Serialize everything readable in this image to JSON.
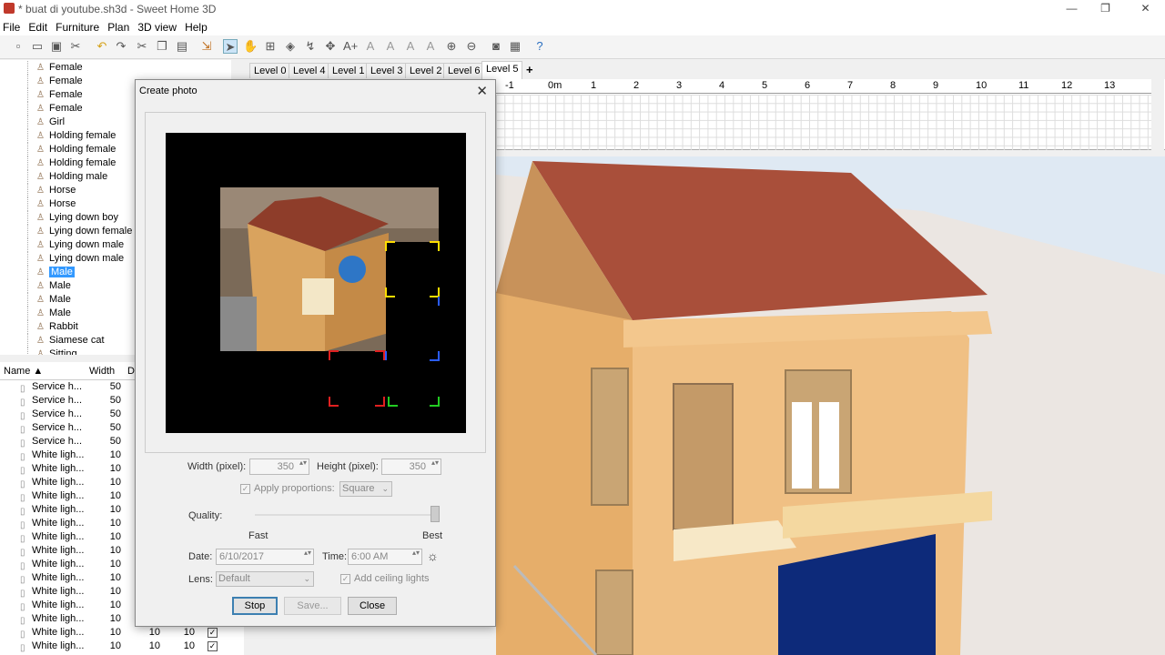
{
  "window": {
    "title": "* buat di youtube.sh3d - Sweet Home 3D"
  },
  "menu": [
    "File",
    "Edit",
    "Furniture",
    "Plan",
    "3D view",
    "Help"
  ],
  "toolbar_icons": [
    "new-icon",
    "open-icon",
    "save-icon",
    "cut-icon",
    "undo-icon",
    "redo-icon",
    "cut-icon",
    "copy-icon",
    "paste-icon",
    "add-furniture-icon",
    "select-icon",
    "pan-icon",
    "create-walls-icon",
    "create-rooms-icon",
    "create-polylines-icon",
    "create-dimensions-icon",
    "add-text-icon",
    "zoom-in-icon",
    "zoom-out-icon",
    "create-photo-icon",
    "create-video-icon",
    "help-icon"
  ],
  "furniture_tree": [
    "Female",
    "Female",
    "Female",
    "Female",
    "Girl",
    "Holding female",
    "Holding female",
    "Holding female",
    "Holding male",
    "Horse",
    "Horse",
    "Lying down boy",
    "Lying down female",
    "Lying down male",
    "Lying down male",
    "Male",
    "Male",
    "Male",
    "Male",
    "Rabbit",
    "Siamese cat",
    "Sitting"
  ],
  "furniture_tree_selected": 15,
  "furniture_table": {
    "columns": [
      "Name ▲",
      "Width",
      "De"
    ],
    "rows": [
      {
        "name": "Service h...",
        "width": "50",
        "depth": "",
        "height": "",
        "visible": false
      },
      {
        "name": "Service h...",
        "width": "50",
        "depth": "",
        "height": "",
        "visible": false
      },
      {
        "name": "Service h...",
        "width": "50",
        "depth": "",
        "height": "",
        "visible": false
      },
      {
        "name": "Service h...",
        "width": "50",
        "depth": "",
        "height": "",
        "visible": false
      },
      {
        "name": "Service h...",
        "width": "50",
        "depth": "",
        "height": "",
        "visible": false
      },
      {
        "name": "White ligh...",
        "width": "10",
        "depth": "",
        "height": "",
        "visible": false
      },
      {
        "name": "White ligh...",
        "width": "10",
        "depth": "",
        "height": "",
        "visible": false
      },
      {
        "name": "White ligh...",
        "width": "10",
        "depth": "",
        "height": "",
        "visible": false
      },
      {
        "name": "White ligh...",
        "width": "10",
        "depth": "",
        "height": "",
        "visible": false
      },
      {
        "name": "White ligh...",
        "width": "10",
        "depth": "",
        "height": "",
        "visible": false
      },
      {
        "name": "White ligh...",
        "width": "10",
        "depth": "",
        "height": "",
        "visible": false
      },
      {
        "name": "White ligh...",
        "width": "10",
        "depth": "",
        "height": "",
        "visible": false
      },
      {
        "name": "White ligh...",
        "width": "10",
        "depth": "",
        "height": "",
        "visible": false
      },
      {
        "name": "White ligh...",
        "width": "10",
        "depth": "",
        "height": "",
        "visible": false
      },
      {
        "name": "White ligh...",
        "width": "10",
        "depth": "",
        "height": "",
        "visible": false
      },
      {
        "name": "White ligh...",
        "width": "10",
        "depth": "",
        "height": "",
        "visible": false
      },
      {
        "name": "White ligh...",
        "width": "10",
        "depth": "",
        "height": "",
        "visible": false
      },
      {
        "name": "White ligh...",
        "width": "10",
        "depth": "",
        "height": "",
        "visible": false
      },
      {
        "name": "White ligh...",
        "width": "10",
        "depth": "10",
        "height": "10",
        "visible": true
      },
      {
        "name": "White ligh...",
        "width": "10",
        "depth": "10",
        "height": "10",
        "visible": true
      },
      {
        "name": "White ligh...",
        "width": "10",
        "depth": "10",
        "height": "10",
        "visible": true
      }
    ]
  },
  "level_tabs": [
    "Level 0",
    "Level 4",
    "Level 1",
    "Level 3",
    "Level 2",
    "Level 6",
    "Level 5"
  ],
  "active_level": "Level 5",
  "add_level_label": "+",
  "ruler_labels": [
    "-1",
    "0m",
    "1",
    "2",
    "3",
    "4",
    "5",
    "6",
    "7",
    "8",
    "9",
    "10",
    "11",
    "12",
    "13"
  ],
  "dialog": {
    "title": "Create photo",
    "close": "✕",
    "width_label": "Width (pixel):",
    "width_value": "350",
    "height_label": "Height (pixel):",
    "height_value": "350",
    "apply_proportions_label": "Apply proportions:",
    "apply_proportions_checked": true,
    "proportions_value": "Square",
    "quality_label": "Quality:",
    "quality_level": 1.0,
    "quality_fast": "Fast",
    "quality_best": "Best",
    "date_label": "Date:",
    "date_value": "6/10/2017",
    "time_label": "Time:",
    "time_value": "6:00 AM",
    "lens_label": "Lens:",
    "lens_value": "Default",
    "ceiling_lights_label": "Add ceiling lights",
    "ceiling_lights_checked": true,
    "stop_button": "Stop",
    "save_button": "Save...",
    "close_button": "Close"
  },
  "colors": {
    "roof": "#a94f3a",
    "wall": "#e8b877",
    "door_blue": "#0d2a7a",
    "sky": "#ebe6e2",
    "selection": "#3399ff"
  }
}
